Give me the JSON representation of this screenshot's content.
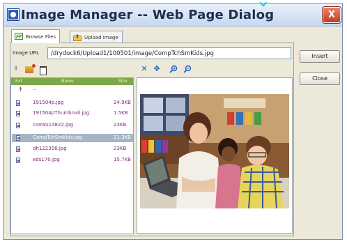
{
  "window": {
    "title": "Image Manager -- Web Page Dialog",
    "close_glyph": "X"
  },
  "tabs": [
    {
      "label": "Browse Files",
      "active": true
    },
    {
      "label": "Upload Image",
      "active": false
    }
  ],
  "url_field": {
    "label": "Image URL",
    "value": "/drydock6/Upload1/100501/image/CompTchSmKids.jpg"
  },
  "buttons": {
    "insert": "Insert",
    "close": "Close"
  },
  "file_list": {
    "columns": [
      "Ext",
      "Name",
      "Size"
    ],
    "parent_label": "..",
    "rows": [
      {
        "name": "191504p.jpg",
        "size": "24.9KB",
        "selected": false
      },
      {
        "name": "191504pThumbnail.jpg",
        "size": "1.5KB",
        "selected": false
      },
      {
        "name": "comks14822.jpg",
        "size": "23KB",
        "selected": false
      },
      {
        "name": "CompTchSmKids.jpg",
        "size": "21.3KB",
        "selected": true
      },
      {
        "name": "dh122316.jpg",
        "size": "23KB",
        "selected": false
      },
      {
        "name": "eds170.jpg",
        "size": "15.7KB",
        "selected": false
      }
    ]
  },
  "icons": {
    "file_toolbar": [
      "up-folder-icon",
      "new-folder-icon",
      "delete-icon"
    ],
    "preview_toolbar": [
      "fit-icon",
      "actual-size-icon",
      "zoom-in-icon",
      "zoom-out-icon"
    ]
  },
  "colors": {
    "list_header": "#7da84a",
    "selected_row": "#a7b3c6",
    "file_name": "#7a2a7a",
    "close_button": "#c23c1d"
  }
}
